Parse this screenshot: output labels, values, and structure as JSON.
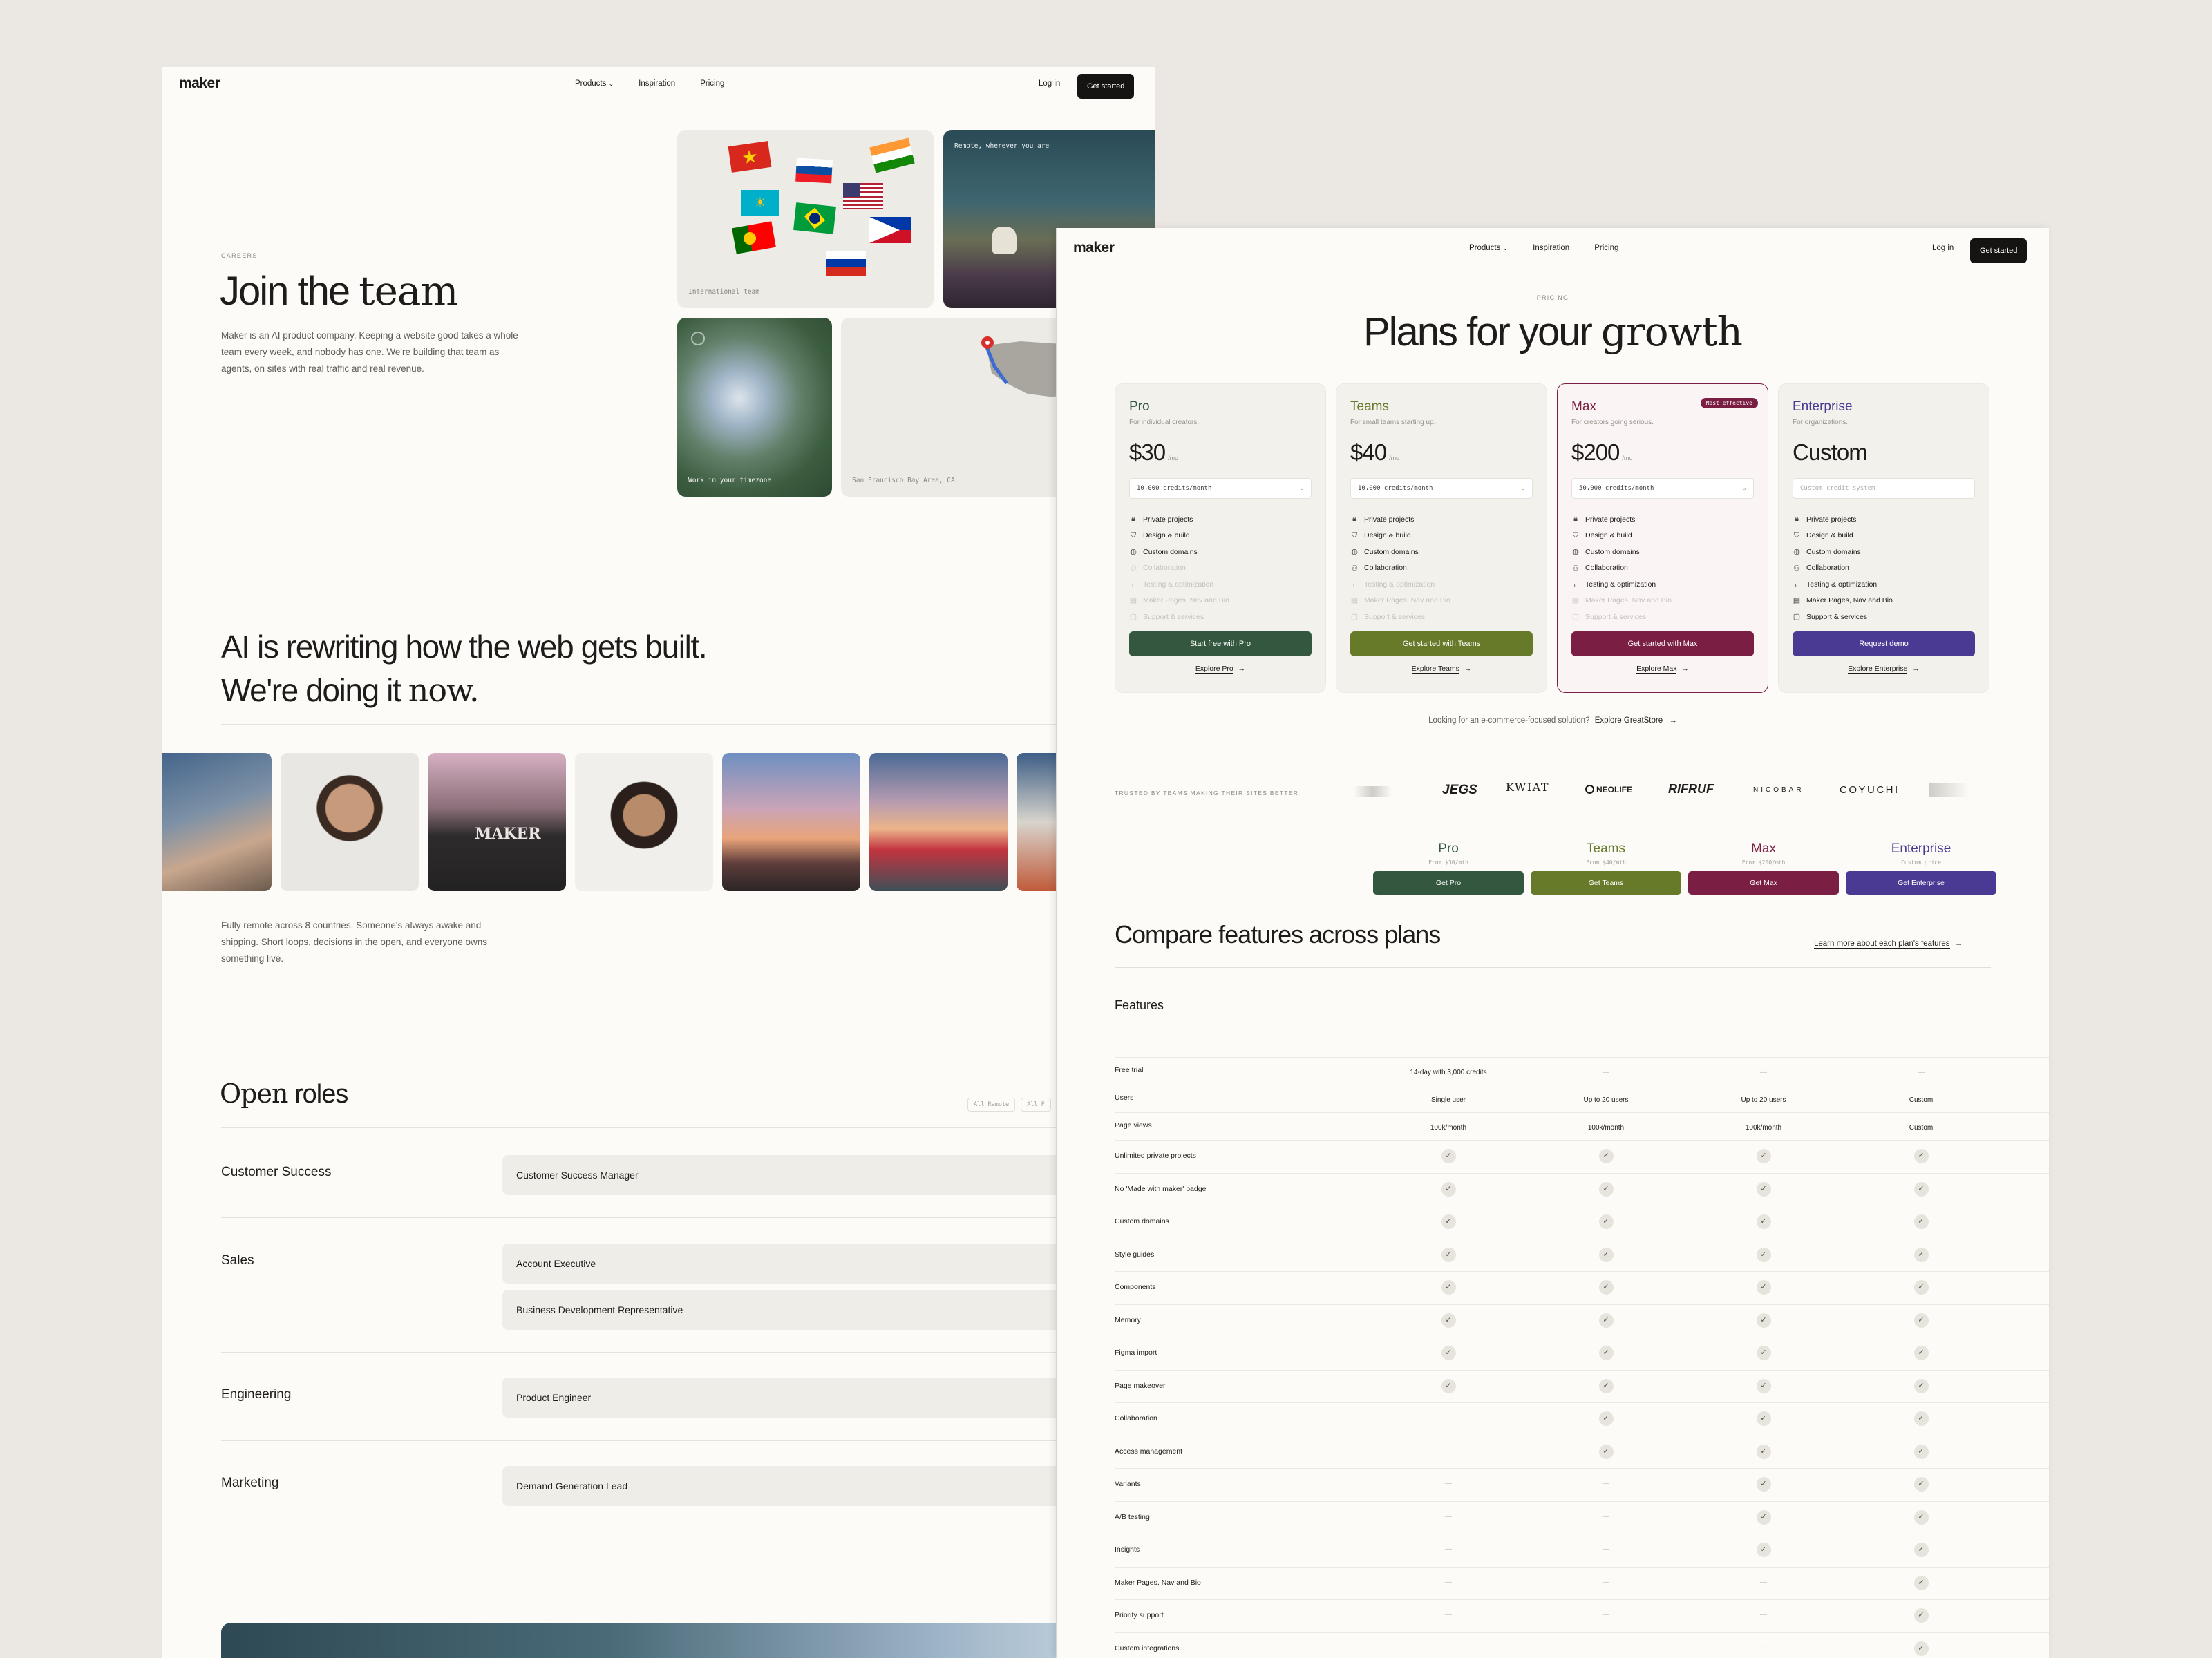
{
  "careers": {
    "nav": {
      "logo": "maker",
      "products": "Products",
      "inspiration": "Inspiration",
      "pricing": "Pricing",
      "login": "Log in",
      "get_started": "Get started"
    },
    "hero": {
      "eyebrow": "CAREERS",
      "title_plain": "Join the ",
      "title_serif": "team",
      "body": "Maker is an AI product company. Keeping a website good takes a whole team every week, and nobody has one. We're building that team as agents, on sites with real traffic and real revenue."
    },
    "tiles": {
      "international": "International team",
      "remote": "Remote, wherever you are",
      "timezone": "Work in your timezone",
      "location": "San Francisco Bay Area, CA"
    },
    "manifesto": {
      "line1": "AI is rewriting how the web gets built.",
      "line2_plain": "We're doing it ",
      "line2_serif": "now."
    },
    "about": "Fully remote across 8 countries. Someone's always awake and shipping. Short loops, decisions in the open, and everyone owns something live.",
    "roles": {
      "title_serif": "Open",
      "title_plain": " roles",
      "filters": [
        "All Remote",
        "All F"
      ],
      "groups": [
        {
          "team": "Customer Success",
          "positions": [
            "Customer Success Manager"
          ]
        },
        {
          "team": "Sales",
          "positions": [
            "Account Executive",
            "Business Development Representative"
          ]
        },
        {
          "team": "Engineering",
          "positions": [
            "Product Engineer"
          ]
        },
        {
          "team": "Marketing",
          "positions": [
            "Demand Generation Lead"
          ]
        }
      ]
    }
  },
  "pricing": {
    "nav": {
      "logo": "maker",
      "products": "Products",
      "inspiration": "Inspiration",
      "pricing": "Pricing",
      "login": "Log in",
      "get_started": "Get started"
    },
    "eyebrow": "PRICING",
    "title_plain": "Plans for your ",
    "title_serif": "growth",
    "plans": [
      {
        "name": "Pro",
        "desc": "For individual creators.",
        "price": "$30",
        "per": "/mo",
        "credits": "10,000 credits/month",
        "button": "Start free with Pro",
        "link": "Explore Pro",
        "color": "#33573f",
        "badge": ""
      },
      {
        "name": "Teams",
        "desc": "For small teams starting up.",
        "price": "$40",
        "per": "/mo",
        "credits": "10,000 credits/month",
        "button": "Get started with Teams",
        "link": "Explore Teams",
        "color": "#667a2a",
        "badge": ""
      },
      {
        "name": "Max",
        "desc": "For creators going serious.",
        "price": "$200",
        "per": "/mo",
        "credits": "50,000 credits/month",
        "button": "Get started with Max",
        "link": "Explore Max",
        "color": "#7a1f43",
        "badge": "Most effective"
      },
      {
        "name": "Enterprise",
        "desc": "For organizations.",
        "price": "Custom",
        "per": "",
        "credits": "Custom credit system",
        "button": "Request demo",
        "link": "Explore Enterprise",
        "color": "#4b3a94",
        "badge": ""
      }
    ],
    "plan_features": [
      "Private projects",
      "Design & build",
      "Custom domains",
      "Collaboration",
      "Testing & optimization",
      "Maker Pages, Nav and Bio",
      "Support & services"
    ],
    "plan_feature_icons": [
      "lock-icon",
      "shield-icon",
      "globe-icon",
      "users-icon",
      "chart-icon",
      "pages-icon",
      "support-icon"
    ],
    "plan_feature_included": [
      [
        1,
        1,
        1,
        0,
        0,
        0,
        0
      ],
      [
        1,
        1,
        1,
        1,
        0,
        0,
        0
      ],
      [
        1,
        1,
        1,
        1,
        1,
        0,
        0
      ],
      [
        1,
        1,
        1,
        1,
        1,
        1,
        1
      ]
    ],
    "ecommerce": {
      "text": "Looking for an e-commerce-focused solution?",
      "link": "Explore GreatStore"
    },
    "trusted": "TRUSTED BY TEAMS MAKING THEIR SITES BETTER",
    "logos": [
      "JEGS",
      "KWIAT",
      "NEOLIFE",
      "RIFRUF",
      "NICOBAR",
      "COYUCHI"
    ],
    "compare": {
      "title": "Compare features across plans",
      "learn_more": "Learn more about each plan's features",
      "features_label": "Features",
      "columns": [
        {
          "name": "Pro",
          "from": "From $30/mth",
          "button": "Get Pro"
        },
        {
          "name": "Teams",
          "from": "From $40/mth",
          "button": "Get Teams"
        },
        {
          "name": "Max",
          "from": "From $200/mth",
          "button": "Get Max"
        },
        {
          "name": "Enterprise",
          "from": "Custom price",
          "button": "Get Enterprise"
        }
      ],
      "rows": [
        {
          "feature": "Free trial",
          "values": [
            "14-day with 3,000 credits",
            "—",
            "—",
            "—"
          ]
        },
        {
          "feature": "Users",
          "values": [
            "Single user",
            "Up to 20 users",
            "Up to 20 users",
            "Custom"
          ]
        },
        {
          "feature": "Page views",
          "values": [
            "100k/month",
            "100k/month",
            "100k/month",
            "Custom"
          ]
        },
        {
          "feature": "Unlimited private projects",
          "values": [
            "check",
            "check",
            "check",
            "check"
          ]
        },
        {
          "feature": "No 'Made with maker' badge",
          "values": [
            "check",
            "check",
            "check",
            "check"
          ]
        },
        {
          "feature": "Custom domains",
          "values": [
            "check",
            "check",
            "check",
            "check"
          ]
        },
        {
          "feature": "Style guides",
          "values": [
            "check",
            "check",
            "check",
            "check"
          ]
        },
        {
          "feature": "Components",
          "values": [
            "check",
            "check",
            "check",
            "check"
          ]
        },
        {
          "feature": "Memory",
          "values": [
            "check",
            "check",
            "check",
            "check"
          ]
        },
        {
          "feature": "Figma import",
          "values": [
            "check",
            "check",
            "check",
            "check"
          ]
        },
        {
          "feature": "Page makeover",
          "values": [
            "check",
            "check",
            "check",
            "check"
          ]
        },
        {
          "feature": "Collaboration",
          "values": [
            "—",
            "check",
            "check",
            "check"
          ]
        },
        {
          "feature": "Access management",
          "values": [
            "—",
            "check",
            "check",
            "check"
          ]
        },
        {
          "feature": "Variants",
          "values": [
            "—",
            "—",
            "check",
            "check"
          ]
        },
        {
          "feature": "A/B testing",
          "values": [
            "—",
            "—",
            "check",
            "check"
          ]
        },
        {
          "feature": "Insights",
          "values": [
            "—",
            "—",
            "check",
            "check"
          ]
        },
        {
          "feature": "Maker Pages, Nav and Bio",
          "values": [
            "—",
            "—",
            "—",
            "check"
          ]
        },
        {
          "feature": "Priority support",
          "values": [
            "—",
            "—",
            "—",
            "check"
          ]
        },
        {
          "feature": "Custom integrations",
          "values": [
            "—",
            "—",
            "—",
            "check"
          ]
        }
      ]
    }
  }
}
